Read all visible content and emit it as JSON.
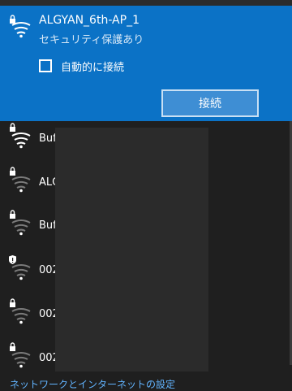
{
  "selected_network": {
    "name": "ALGYAN_6th-AP_1",
    "status": "セキュリティ保護あり",
    "auto_connect_label": "自動的に接続",
    "auto_connect_checked": false,
    "connect_button_label": "接続",
    "icon": "wifi-secured-icon"
  },
  "networks": [
    {
      "name": "Buf",
      "icon": "wifi-secured-icon",
      "signal": "full"
    },
    {
      "name": "ALC",
      "icon": "wifi-secured-icon",
      "signal": "weak"
    },
    {
      "name": "Buf",
      "icon": "wifi-secured-icon",
      "signal": "weak"
    },
    {
      "name": "002",
      "icon": "wifi-shield-icon",
      "signal": "weak"
    },
    {
      "name": "002",
      "icon": "wifi-secured-icon",
      "signal": "weak"
    },
    {
      "name": "002",
      "icon": "wifi-secured-icon",
      "signal": "weak"
    }
  ],
  "footer": {
    "settings_link": "ネットワークとインターネットの設定"
  },
  "colors": {
    "accent": "#0b72c6",
    "panel_bg": "#1f1f1f",
    "link": "#62b4ff"
  }
}
